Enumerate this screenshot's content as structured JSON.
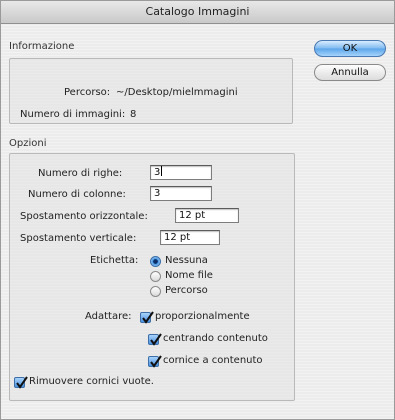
{
  "window": {
    "title": "Catalogo Immagini"
  },
  "info": {
    "section_label": "Informazione",
    "path_label": "Percorso:",
    "path_value": "~/Desktop/mielmmagini",
    "count_label": "Numero di immagini:",
    "count_value": "8"
  },
  "buttons": {
    "ok": "OK",
    "cancel": "Annulla"
  },
  "options": {
    "section_label": "Opzioni",
    "rows_label": "Numero di righe:",
    "rows_value": "3",
    "cols_label": "Numero di colonne:",
    "cols_value": "3",
    "hspace_label": "Spostamento orizzontale:",
    "hspace_value": "12 pt",
    "vspace_label": "Spostamento verticale:",
    "vspace_value": "12 pt",
    "caption_label": "Etichetta:",
    "caption_options": [
      "Nessuna",
      "Nome file",
      "Percorso"
    ],
    "caption_selected": "Nessuna",
    "fit_label": "Adattare:",
    "fit_options": [
      "proporzionalmente",
      "centrando contenuto",
      "cornice a contenuto"
    ],
    "remove_empty": "Rimuovere cornici vuote."
  }
}
